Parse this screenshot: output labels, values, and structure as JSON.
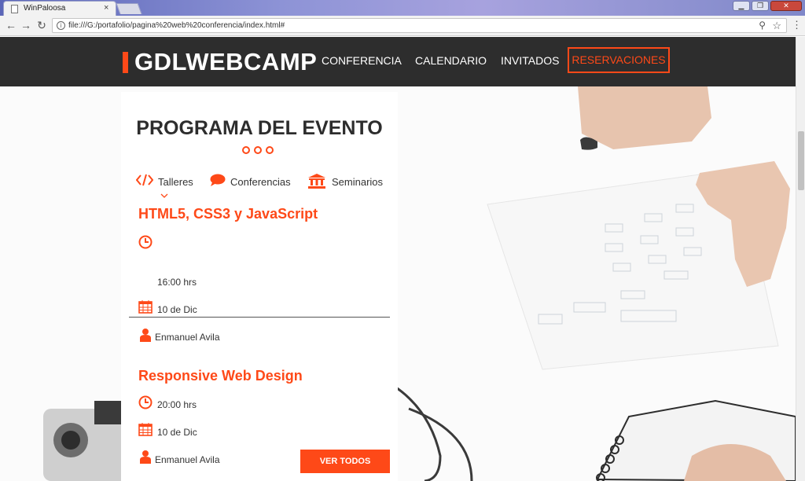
{
  "browser": {
    "tab_title": "WinPaloosa",
    "tab_close": "×",
    "url": "file:///G:/portafolio/pagina%20web%20conferencia/index.html#",
    "window_controls": [
      "▁",
      "❐",
      "✕"
    ]
  },
  "header": {
    "logo": "GDLWEBCAMP",
    "nav": [
      "CONFERENCIA",
      "CALENDARIO",
      "INVITADOS"
    ],
    "cta": "RESERVACIONES"
  },
  "program": {
    "title": "PROGRAMA DEL EVENTO",
    "categories": [
      {
        "label": "Talleres",
        "icon": "code-icon"
      },
      {
        "label": "Conferencias",
        "icon": "speech-bubble-icon"
      },
      {
        "label": "Seminarios",
        "icon": "institution-icon"
      }
    ],
    "events": [
      {
        "title": "HTML5, CSS3 y JavaScript",
        "time": "16:00 hrs",
        "date": "10 de Dic",
        "speaker": "Enmanuel Avila"
      },
      {
        "title": "Responsive Web Design",
        "time": "20:00 hrs",
        "date": "10 de Dic",
        "speaker": "Enmanuel Avila"
      }
    ],
    "view_all": "VER TODOS"
  },
  "colors": {
    "accent": "#fe4918",
    "header_bg": "#2d2d2d",
    "text_dark": "#2d2d2d"
  }
}
